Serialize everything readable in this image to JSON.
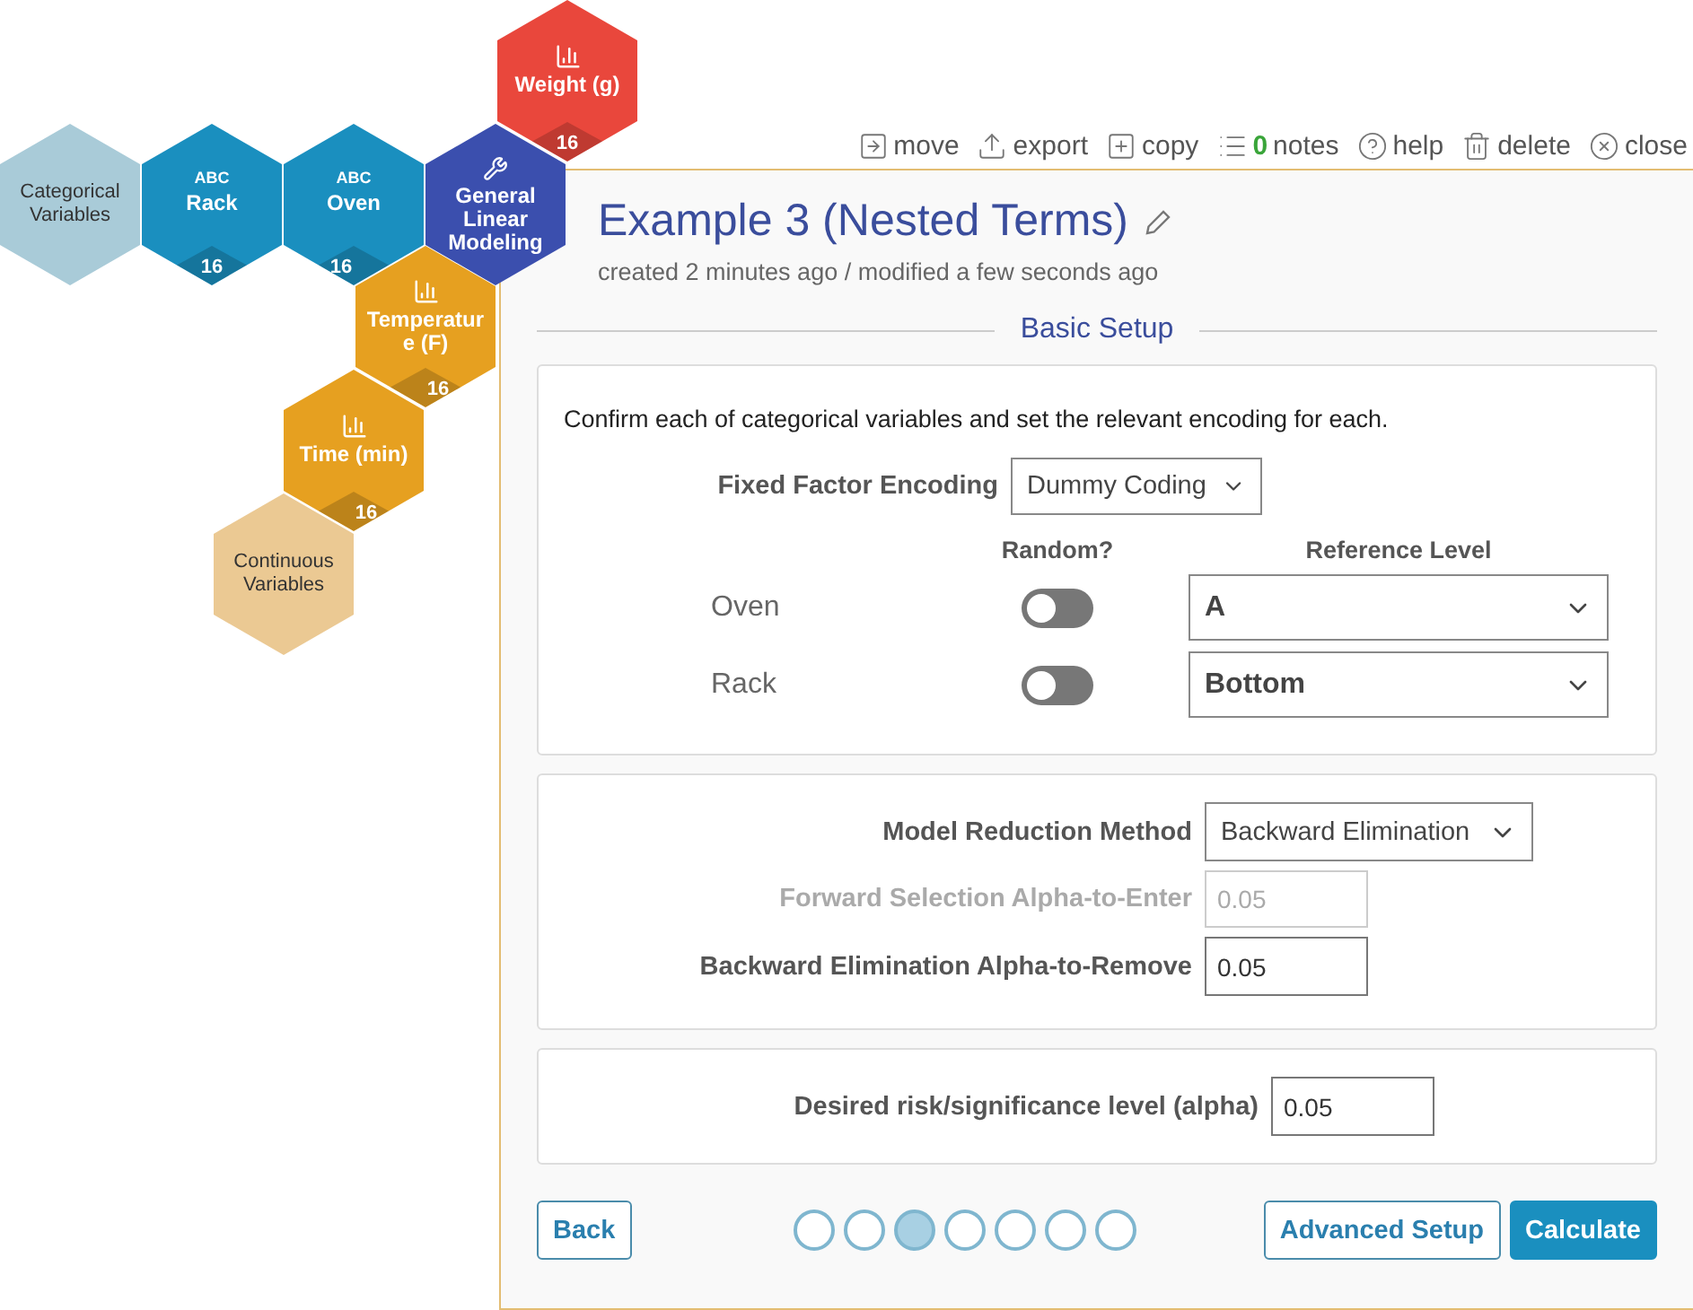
{
  "nodes": [
    {
      "kind": "group",
      "label": "Categorical Variables",
      "color": "#a9cbd8"
    },
    {
      "kind": "categorical",
      "badge": "ABC",
      "label": "Rack",
      "count": "16",
      "color": "#1a8fbf"
    },
    {
      "kind": "categorical",
      "badge": "ABC",
      "label": "Oven",
      "count": "16",
      "color": "#1a8fbf"
    },
    {
      "kind": "model",
      "label": "General Linear Modeling",
      "color": "#3b4fae"
    },
    {
      "kind": "continuous",
      "label": "Weight (g)",
      "count": "16",
      "color": "#e9473c"
    },
    {
      "kind": "continuous",
      "label": "Temperatur e (F)",
      "count": "16",
      "color": "#e6a020"
    },
    {
      "kind": "continuous",
      "label": "Time (min)",
      "count": "16",
      "color": "#e6a020"
    },
    {
      "kind": "group",
      "label": "Continuous Variables",
      "color": "#ebc993"
    }
  ],
  "toolbar": [
    {
      "kind": "move",
      "label": "move"
    },
    {
      "kind": "export",
      "label": "export"
    },
    {
      "kind": "copy",
      "label": "copy"
    },
    {
      "kind": "notes",
      "count": "0",
      "label": "notes"
    },
    {
      "kind": "help",
      "label": "help"
    },
    {
      "kind": "delete",
      "label": "delete"
    },
    {
      "kind": "close",
      "label": "close"
    }
  ],
  "title": "Example 3 (Nested Terms)",
  "subtitle": "created 2 minutes ago / modified a few seconds ago",
  "section": "Basic Setup",
  "instruction": "Confirm each of categorical variables and set the relevant encoding for each.",
  "encoding": {
    "label": "Fixed Factor Encoding",
    "value": "Dummy Coding"
  },
  "variable_columns": [
    "Random?",
    "Reference Level"
  ],
  "variables": [
    {
      "name": "Oven",
      "random": false,
      "reference": "A"
    },
    {
      "name": "Rack",
      "random": false,
      "reference": "Bottom"
    }
  ],
  "reduction": [
    {
      "kind": "select",
      "label": "Model Reduction Method",
      "value": "Backward Elimination",
      "disabled": false
    },
    {
      "kind": "input",
      "label": "Forward Selection Alpha-to-Enter",
      "value": "0.05",
      "disabled": true
    },
    {
      "kind": "input",
      "label": "Backward Elimination Alpha-to-Remove",
      "value": "0.05",
      "disabled": false
    }
  ],
  "alpha": {
    "label": "Desired risk/significance level (alpha)",
    "value": "0.05"
  },
  "back": "Back",
  "steps": [
    {
      "selected": false
    },
    {
      "selected": false
    },
    {
      "selected": true
    },
    {
      "selected": false
    },
    {
      "selected": false
    },
    {
      "selected": false
    },
    {
      "selected": false
    }
  ],
  "advanced": "Advanced Setup",
  "calculate": "Calculate"
}
